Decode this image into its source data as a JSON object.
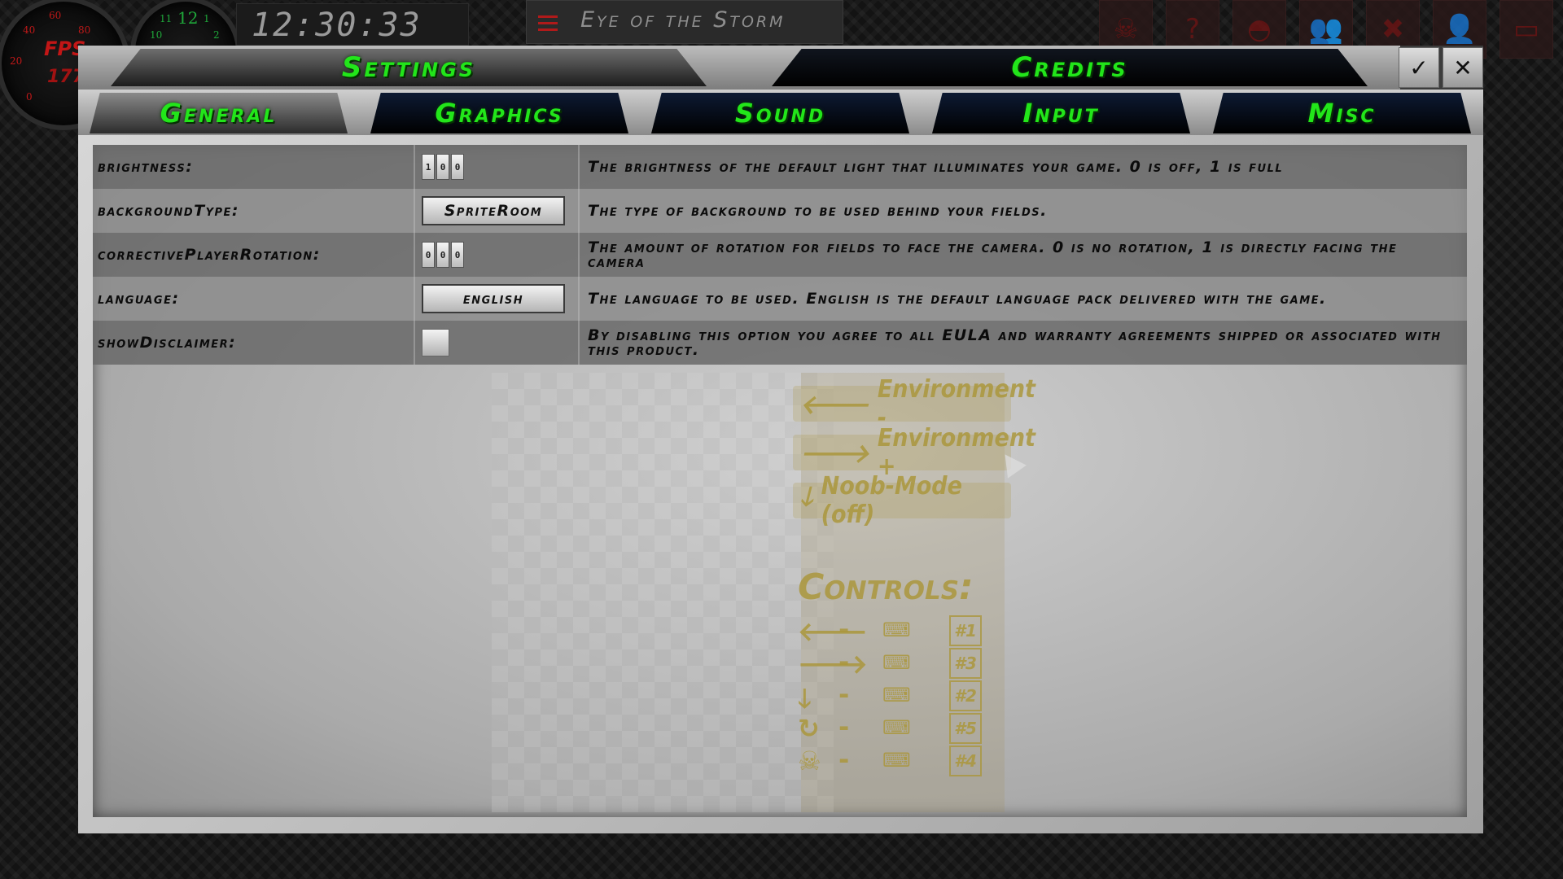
{
  "hud": {
    "fps_gauge": {
      "label": "FPS",
      "value": "177",
      "ticks": [
        "60",
        "40",
        "80",
        "20",
        "0"
      ]
    },
    "clock_gauge": {
      "ticks": [
        "12",
        "11",
        "1",
        "10",
        "2"
      ]
    },
    "time": "12:30:33",
    "level_name": "Eye of the Storm",
    "icons": [
      "skull-icon",
      "help-icon",
      "helmet-icon",
      "players-icon",
      "tools-icon",
      "user-icon",
      "monitor-icon"
    ]
  },
  "dialog": {
    "main_tabs": [
      {
        "label": "Settings",
        "active": true
      },
      {
        "label": "Credits",
        "active": false
      }
    ],
    "confirm_symbol": "✓",
    "close_symbol": "✕",
    "sub_tabs": [
      {
        "label": "General",
        "active": true
      },
      {
        "label": "Graphics",
        "active": false
      },
      {
        "label": "Sound",
        "active": false
      },
      {
        "label": "Input",
        "active": false
      },
      {
        "label": "Misc",
        "active": false
      }
    ],
    "settings": [
      {
        "label": "brightness:",
        "control": "number",
        "digits": [
          "1",
          "0",
          "0"
        ],
        "description": "The brightness of the default light that illuminates your game. 0 is off, 1 is full"
      },
      {
        "label": "backgroundType:",
        "control": "select",
        "value": "SpriteRoom",
        "description": "The type of background to be used behind your fields."
      },
      {
        "label": "correctivePlayerRotation:",
        "control": "number",
        "digits": [
          "0",
          "0",
          "0"
        ],
        "description": "The amount of rotation for fields to face the camera. 0 is no rotation, 1 is directly facing the camera"
      },
      {
        "label": "language:",
        "control": "select",
        "value": "english",
        "description": "The language to be used. English is the default language pack delivered with the game."
      },
      {
        "label": "showDisclaimer:",
        "control": "checkbox",
        "checked": false,
        "description": "By disabling this option you agree to all EULA and warranty agreements shipped or associated with this product."
      }
    ]
  },
  "background_menu": {
    "buttons": [
      {
        "arrow": "🡐",
        "label": "Environment -"
      },
      {
        "arrow": "🡒",
        "label": "Environment +"
      },
      {
        "arrow": "🡓",
        "label": "Noob-Mode (off)"
      }
    ],
    "controls_title": "Controls:",
    "controls": [
      {
        "icon": "🡐",
        "dash": "-",
        "key": "⌨",
        "num": "#1"
      },
      {
        "icon": "🡒",
        "dash": "-",
        "key": "⌨",
        "num": "#3"
      },
      {
        "icon": "🡓",
        "dash": "-",
        "key": "⌨",
        "num": "#2"
      },
      {
        "icon": "↻",
        "dash": "-",
        "key": "⌨",
        "num": "#5"
      },
      {
        "icon": "☠",
        "dash": "-",
        "key": "⌨",
        "num": "#4"
      }
    ]
  },
  "colors": {
    "tab_text": "#22e61a",
    "hud_red": "#c21616"
  }
}
